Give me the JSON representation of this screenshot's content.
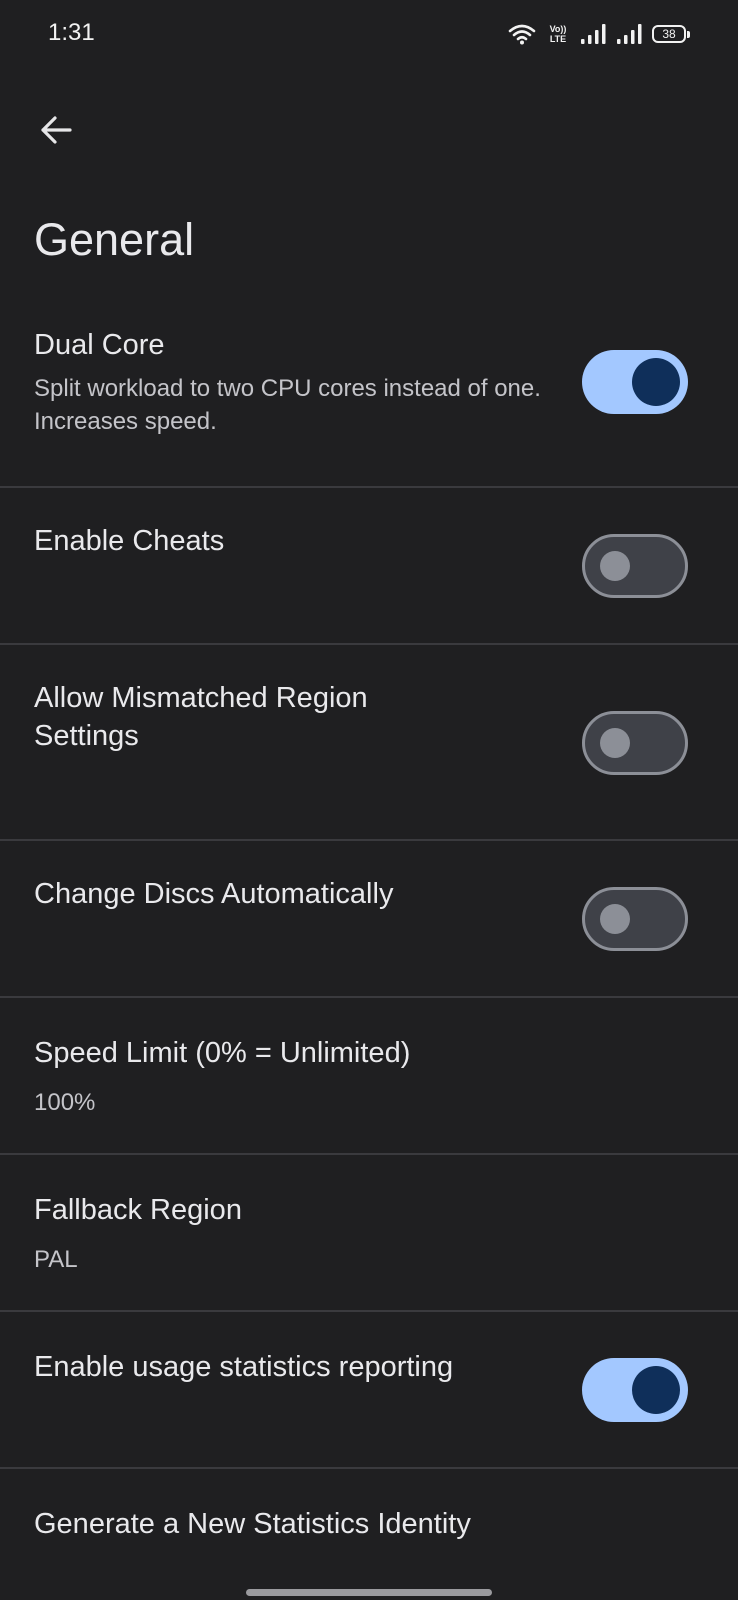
{
  "status_bar": {
    "time": "1:31",
    "volte_top": "Vo))",
    "volte_bottom": "LTE",
    "battery": "38",
    "icons": [
      "wifi-icon",
      "volte-icon",
      "signal-icon",
      "signal-icon",
      "battery-icon"
    ]
  },
  "header": {
    "back_icon": "arrow-left-icon",
    "title": "General"
  },
  "settings": [
    {
      "title": "Dual Core",
      "description": "Split workload to two CPU cores instead of one. Increases speed.",
      "toggle": "on"
    },
    {
      "title": "Enable Cheats",
      "toggle": "off"
    },
    {
      "title": "Allow Mismatched Region Settings",
      "toggle": "off"
    },
    {
      "title": "Change Discs Automatically",
      "toggle": "off"
    },
    {
      "title": "Speed Limit (0% = Unlimited)",
      "value": "100%"
    },
    {
      "title": "Fallback Region",
      "value": "PAL"
    },
    {
      "title": "Enable usage statistics reporting",
      "toggle": "on"
    },
    {
      "title": "Generate a New Statistics Identity"
    }
  ],
  "colors": {
    "background": "#1f1f21",
    "toggle_on_track": "#a3c8ff",
    "toggle_on_knob": "#0f2f5a",
    "toggle_off_track": "#3f4148",
    "toggle_off_outline": "#8c8f97",
    "divider": "#3a3a3e"
  }
}
